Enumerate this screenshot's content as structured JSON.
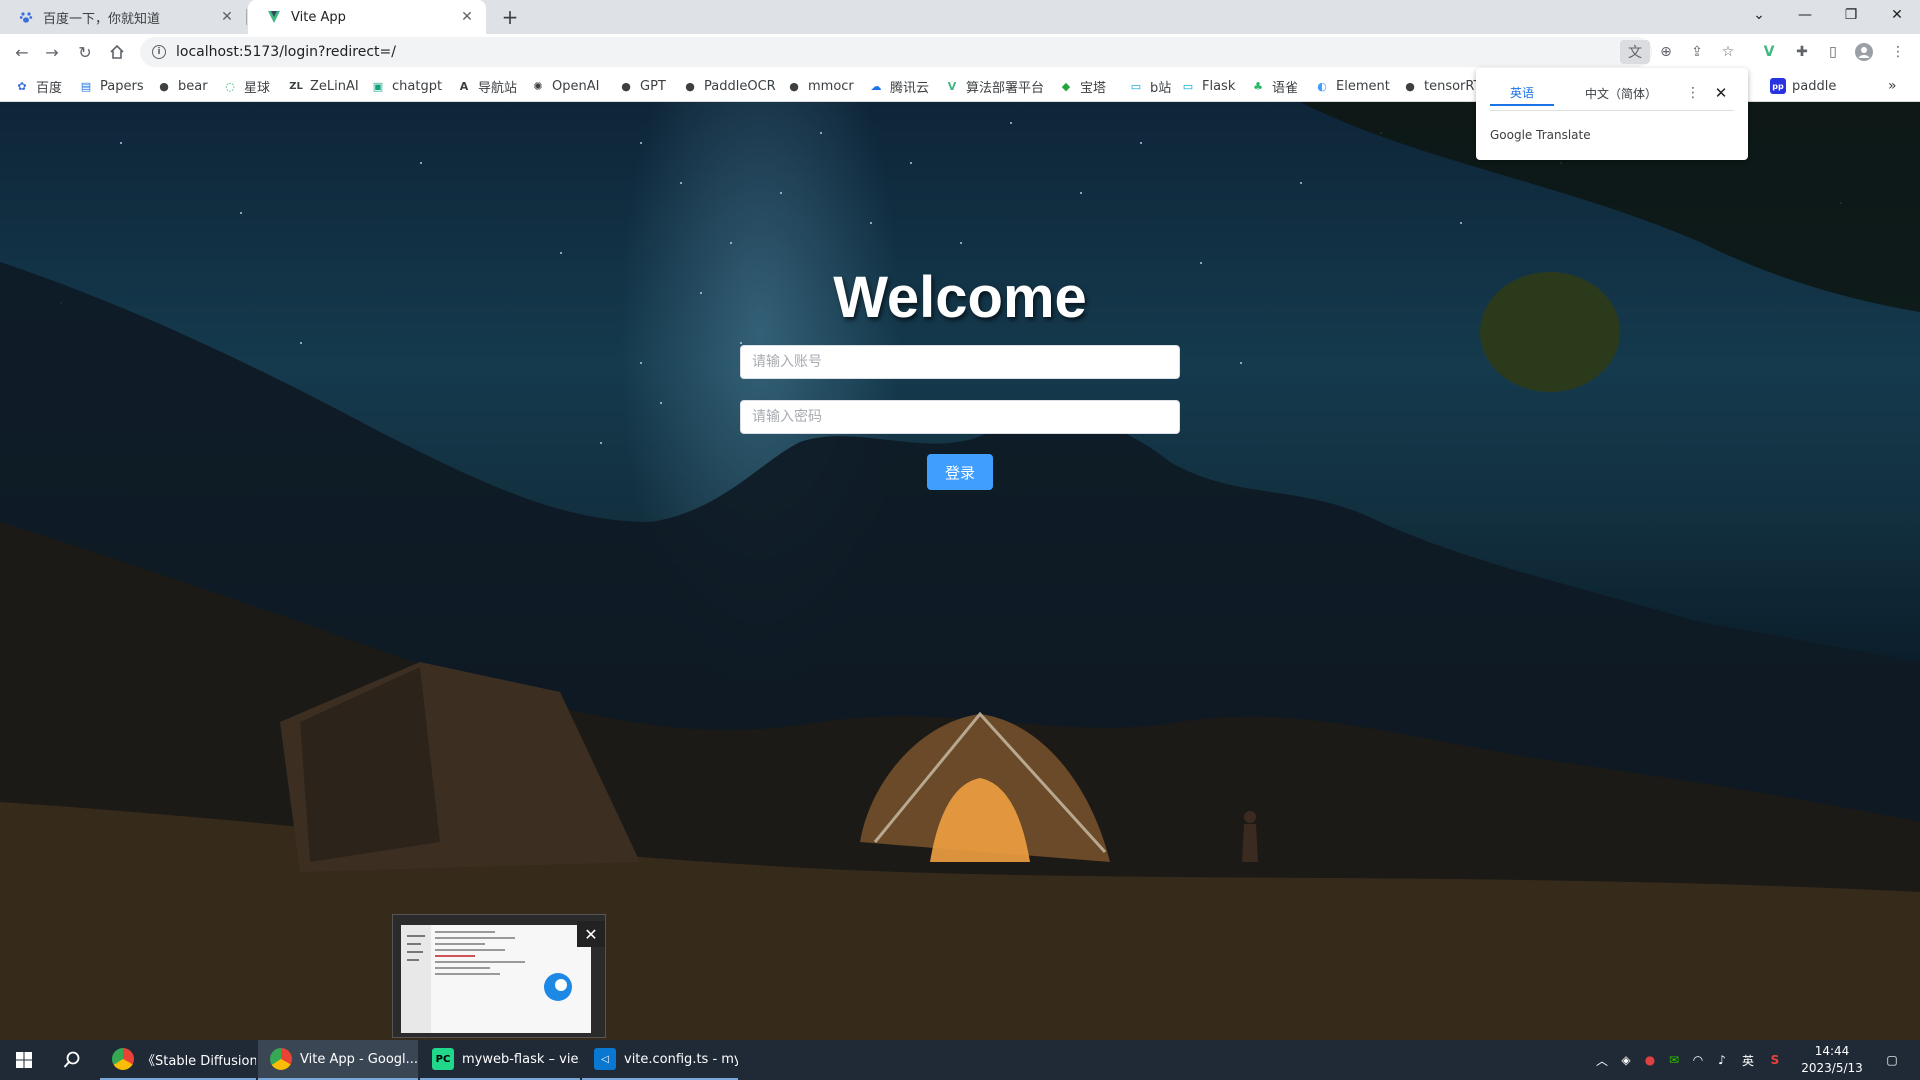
{
  "browser": {
    "tabs": [
      {
        "title": "百度一下，你就知道",
        "icon": "baidu-paw-icon"
      },
      {
        "title": "Vite App",
        "icon": "vite-logo-icon"
      }
    ],
    "url": "localhost:5173/login?redirect=/"
  },
  "bookmarks": [
    {
      "label": "百度"
    },
    {
      "label": "Papers"
    },
    {
      "label": "bear"
    },
    {
      "label": "星球"
    },
    {
      "label": "ZeLinAI"
    },
    {
      "label": "chatgpt"
    },
    {
      "label": "导航站"
    },
    {
      "label": "OpenAI"
    },
    {
      "label": "GPT"
    },
    {
      "label": "PaddleOCR"
    },
    {
      "label": "mmocr"
    },
    {
      "label": "腾讯云"
    },
    {
      "label": "算法部署平台"
    },
    {
      "label": "宝塔"
    },
    {
      "label": "b站"
    },
    {
      "label": "Flask"
    },
    {
      "label": "语雀"
    },
    {
      "label": "Element"
    },
    {
      "label": "tensorRT"
    },
    {
      "label": "paddle"
    }
  ],
  "translate_popup": {
    "tab_selected": "英语",
    "tab_other": "中文（简体）",
    "brand": "Google Translate"
  },
  "login": {
    "title": "Welcome",
    "username_placeholder": "请输入账号",
    "password_placeholder": "请输入密码",
    "submit_label": "登录",
    "accent_color": "#409eff"
  },
  "taskbar": {
    "apps": [
      {
        "label": "《Stable Diffusion...",
        "icon": "chrome-icon"
      },
      {
        "label": "Vite App - Googl...",
        "icon": "chrome-icon"
      },
      {
        "label": "myweb-flask – vie...",
        "icon": "pycharm-icon"
      },
      {
        "label": "vite.config.ts - my...",
        "icon": "vscode-icon"
      }
    ],
    "ime": "英",
    "time": "14:44",
    "date": "2023/5/13"
  }
}
